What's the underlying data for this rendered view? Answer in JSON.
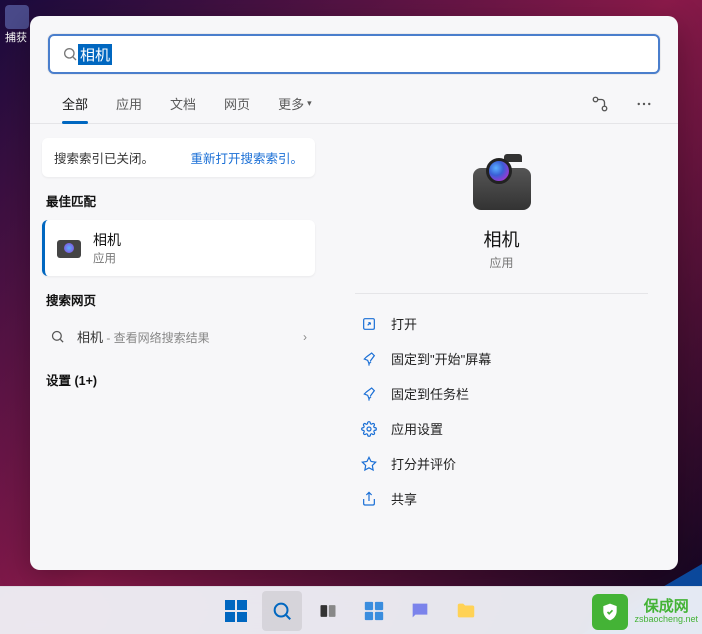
{
  "search": {
    "query": "相机"
  },
  "tabs": {
    "all": "全部",
    "apps": "应用",
    "docs": "文档",
    "web": "网页",
    "more": "更多"
  },
  "indexNotice": {
    "message": "搜索索引已关闭。",
    "link": "重新打开搜索索引。"
  },
  "sections": {
    "bestMatch": "最佳匹配",
    "searchWeb": "搜索网页",
    "settings": "设置 (1+)"
  },
  "bestMatch": {
    "title": "相机",
    "subtitle": "应用"
  },
  "webSearch": {
    "term": "相机",
    "hint": " - 查看网络搜索结果"
  },
  "preview": {
    "title": "相机",
    "subtitle": "应用"
  },
  "actions": {
    "open": "打开",
    "pinStart": "固定到\"开始\"屏幕",
    "pinTaskbar": "固定到任务栏",
    "appSettings": "应用设置",
    "rate": "打分并评价",
    "share": "共享"
  },
  "watermark": {
    "line1": "保成网",
    "line2": "zsbaocheng.net"
  },
  "desktop": {
    "captureLabel": "捕获"
  }
}
